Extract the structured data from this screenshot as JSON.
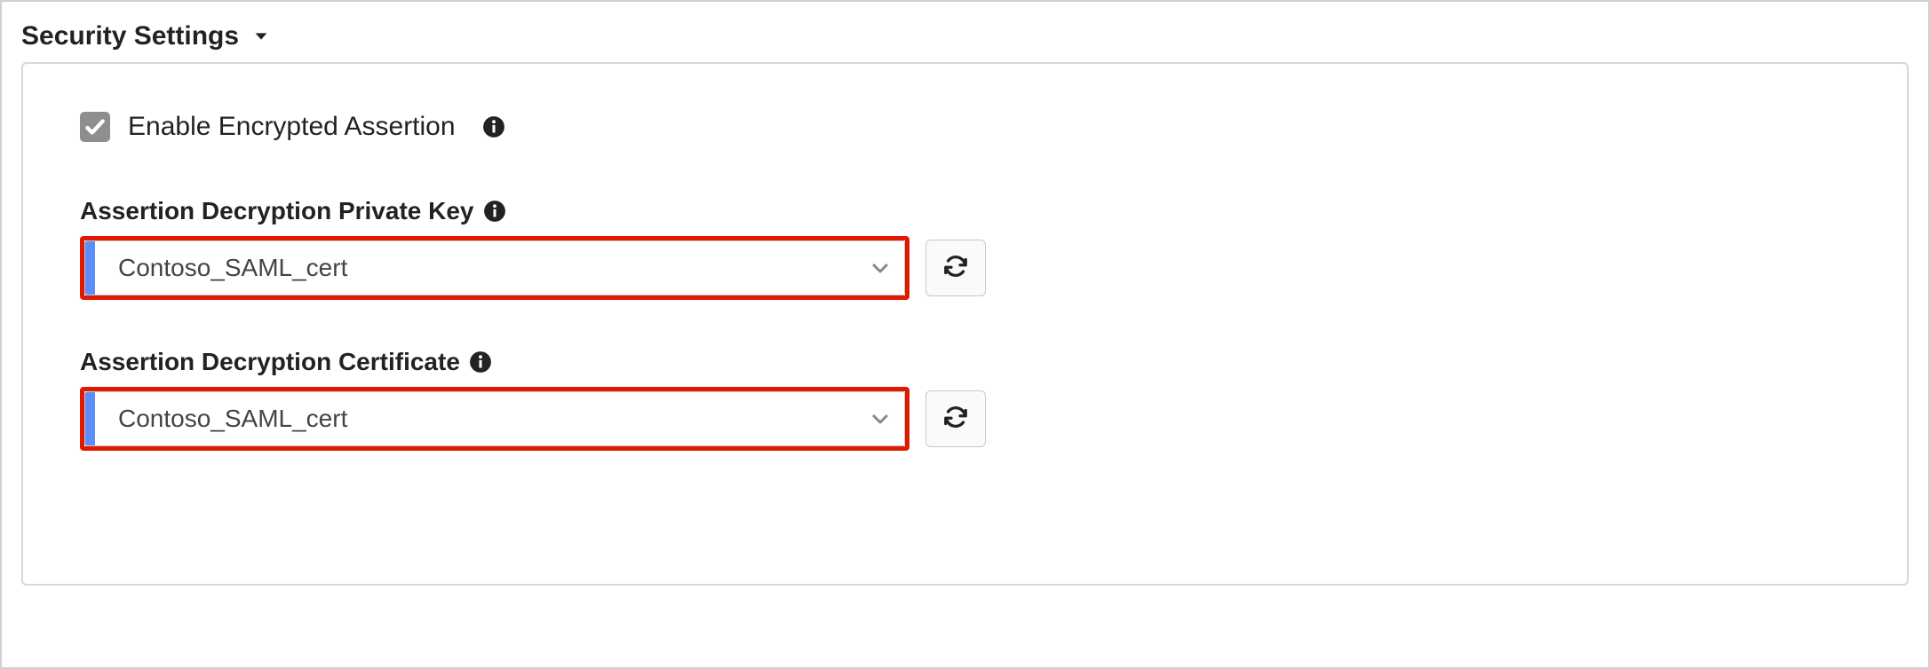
{
  "section": {
    "title": "Security Settings"
  },
  "settings": {
    "enable_encrypted_assertion": {
      "label": "Enable Encrypted Assertion",
      "checked": true
    },
    "private_key": {
      "label": "Assertion Decryption Private Key",
      "value": "Contoso_SAML_cert"
    },
    "certificate": {
      "label": "Assertion Decryption Certificate",
      "value": "Contoso_SAML_cert"
    }
  },
  "colors": {
    "highlight_border": "#e11900",
    "select_accent": "#5d8df7",
    "checkbox_fill": "#8e8e8e"
  }
}
